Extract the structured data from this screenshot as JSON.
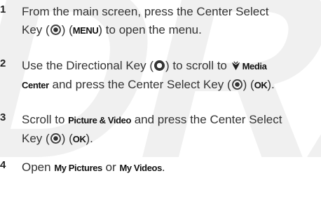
{
  "watermark": "DRAFT",
  "steps": [
    {
      "number": "1",
      "t1": "From the main screen, press the Center Select",
      "t2": "Key (",
      "t3": ") (",
      "k1": "MENU",
      "t4": ") to open the menu."
    },
    {
      "number": "2",
      "t1": "Use the Directional Key (",
      "t2": ") to scroll to ",
      "k1": "Media",
      "k2": "Center",
      "t3": " and press the Center Select Key (",
      "t4": ") (",
      "k3": "OK",
      "t5": ")."
    },
    {
      "number": "3",
      "t1": "Scroll to ",
      "k1": "Picture & Video",
      "t2": " and press the Center Select",
      "t3": "Key (",
      "t4": ") (",
      "k2": "OK",
      "t5": ")."
    },
    {
      "number": "4",
      "t1": "Open ",
      "k1": "My Pictures",
      "t2": " or ",
      "k2": "My Videos",
      "t3": "."
    }
  ],
  "icons": {
    "center_select": "center-select-key-icon",
    "directional": "directional-key-icon",
    "media_center": "media-center-icon"
  }
}
